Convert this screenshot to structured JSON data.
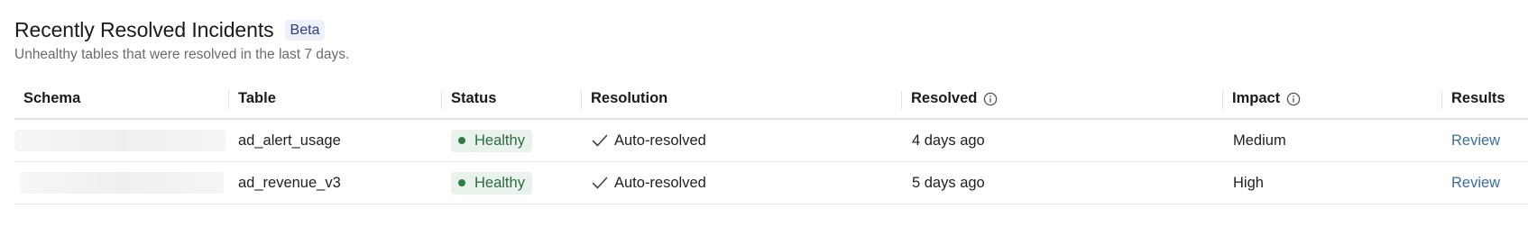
{
  "header": {
    "title": "Recently Resolved Incidents",
    "badge": "Beta",
    "subtitle": "Unhealthy tables that were resolved in the last 7 days."
  },
  "table": {
    "columns": {
      "schema": "Schema",
      "table": "Table",
      "status": "Status",
      "resolution": "Resolution",
      "resolved": "Resolved",
      "impact": "Impact",
      "results": "Results"
    },
    "rows": [
      {
        "table": "ad_alert_usage",
        "status": "Healthy",
        "resolution": "Auto-resolved",
        "resolved": "4 days ago",
        "impact": "Medium",
        "results": "Review"
      },
      {
        "table": "ad_revenue_v3",
        "status": "Healthy",
        "resolution": "Auto-resolved",
        "resolved": "5 days ago",
        "impact": "High",
        "results": "Review"
      }
    ]
  },
  "colors": {
    "healthy_bg": "#e9f3ec",
    "healthy_text": "#2c6b3f",
    "link": "#3a6ea5",
    "badge_bg": "#eef0fb"
  },
  "icons": {
    "info": "info-circle-icon",
    "check": "checkmark-icon",
    "status_dot": "status-dot-icon"
  }
}
